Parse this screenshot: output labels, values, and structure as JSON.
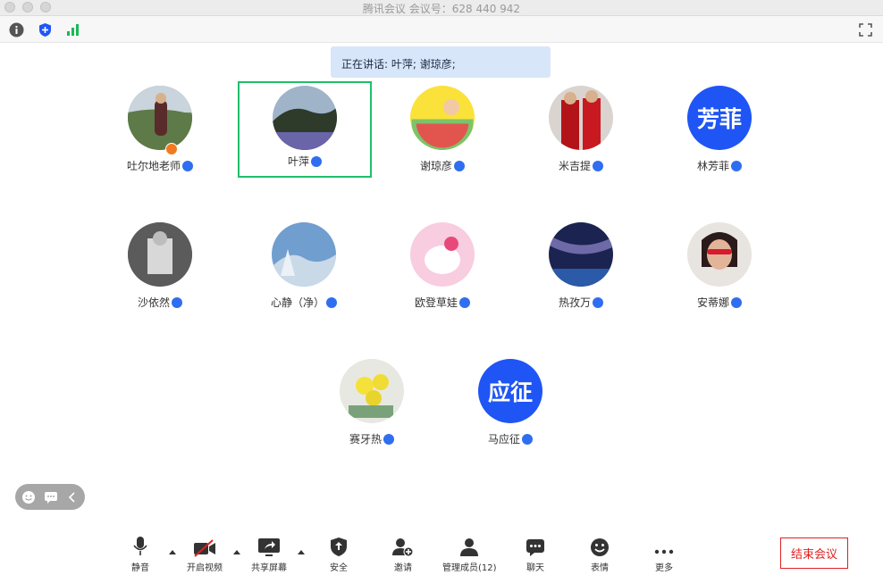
{
  "window": {
    "title": "腾讯会议 会议号：628 440 942"
  },
  "speaking_banner": "正在讲话: 叶萍; 谢琼彦;",
  "participants": [
    {
      "name": "吐尔地老师"
    },
    {
      "name": "叶萍"
    },
    {
      "name": "谢琼彦"
    },
    {
      "name": "米吉提"
    },
    {
      "name": "林芳菲",
      "avatar_text": "芳菲"
    },
    {
      "name": "沙依然"
    },
    {
      "name": "心静（净）"
    },
    {
      "name": "欧登草娃"
    },
    {
      "name": "热孜万"
    },
    {
      "name": "安蒂娜"
    },
    {
      "name": "赛牙热"
    },
    {
      "name": "马应征",
      "avatar_text": "应征"
    }
  ],
  "toolbar": {
    "mute": "静音",
    "video": "开启视频",
    "share": "共享屏幕",
    "security": "安全",
    "invite": "邀请",
    "members": "管理成员(12)",
    "chat": "聊天",
    "reactions": "表情",
    "more": "更多",
    "end": "结束会议"
  },
  "colors": {
    "accent": "#1f55f5",
    "active_border": "#1fbf6a",
    "end": "#e02020",
    "banner": "#d8e6fa"
  }
}
